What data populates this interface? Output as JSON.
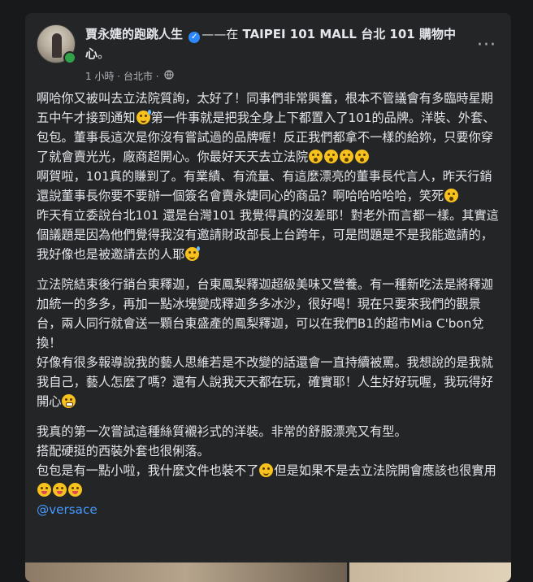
{
  "post": {
    "author": "賈永婕的跑跳人生",
    "with_text": "——在",
    "place": "TAIPEI 101 MALL 台北 101 購物中心",
    "place_suffix": "。",
    "time": "1 小時",
    "location_meta": "台北市",
    "separator": "·",
    "more_icon": "more-horizontal-icon",
    "privacy_icon": "globe-icon",
    "verified_icon": "verified-badge-icon"
  },
  "content": {
    "p1_a": "啊哈你又被叫去立法院質詢，太好了！同事們非常興奮，根本不管議會有多臨時星期五中午才接到通知",
    "p1_b": "第一件事就是把我全身上下都置入了101的品牌。洋裝、外套、包包。董事長這次是你沒有嘗試過的品牌喔！反正我們都拿不一樣的給妳，只要你穿了就會賣光光，廠商超開心。你最好天天去立法院",
    "p1_c": "\n啊賀啦，101真的賺到了。有業績、有流量、有這麼漂亮的董事長代言人，昨天行銷還說董事長你要不要辦一個簽名會賣永婕同心的商品？啊哈哈哈哈哈，笑死",
    "p1_d": "\n昨天有立委說台北101 還是台灣101 我覺得真的沒差耶！對老外而言都一樣。其實這個議題是因為他們覺得我沒有邀請財政部長上台跨年，可是問題是不是我能邀請的，我好像也是被邀請去的人耶",
    "p2_a": "立法院結束後行銷台東釋迦，台東鳳梨釋迦超級美味又營養。有一種新吃法是將釋迦加統一的多多，再加一點冰塊變成釋迦多多冰沙，很好喝！現在只要來我們的觀景台，兩人同行就會送一顆台東盛產的鳳梨釋迦，可以在我們B1的超市Mia C'bon兌換！\n好像有很多報導說我的藝人思維若是不改變的話還會一直持續被罵。我想說的是我就我自己，藝人怎麼了嗎？還有人說我天天都在玩，確實耶！人生好好玩喔，我玩得好開心",
    "p3_a": "我真的第一次嘗試這種絲質襯衫式的洋裝。非常的舒服漂亮又有型。\n搭配硬挺的西裝外套也很俐落。\n包包是有一點小啦，我什麼文件也裝不了",
    "p3_b": "但是如果不是去立法院開會應該也很實用",
    "mention": "@versace"
  },
  "emoji": {
    "sweat_smile": "grinning-sweat-emoji",
    "shocked": "astonished-face-emoji",
    "grin": "grimacing-face-emoji",
    "smiling": "smiling-face-emoji",
    "tongue": "tongue-face-emoji"
  },
  "colors": {
    "background": "#18191a",
    "card": "#242526",
    "text": "#e4e6eb",
    "secondary": "#b0b3b8",
    "link": "#4599ff",
    "verified": "#2d88ff",
    "online": "#31a24c"
  }
}
